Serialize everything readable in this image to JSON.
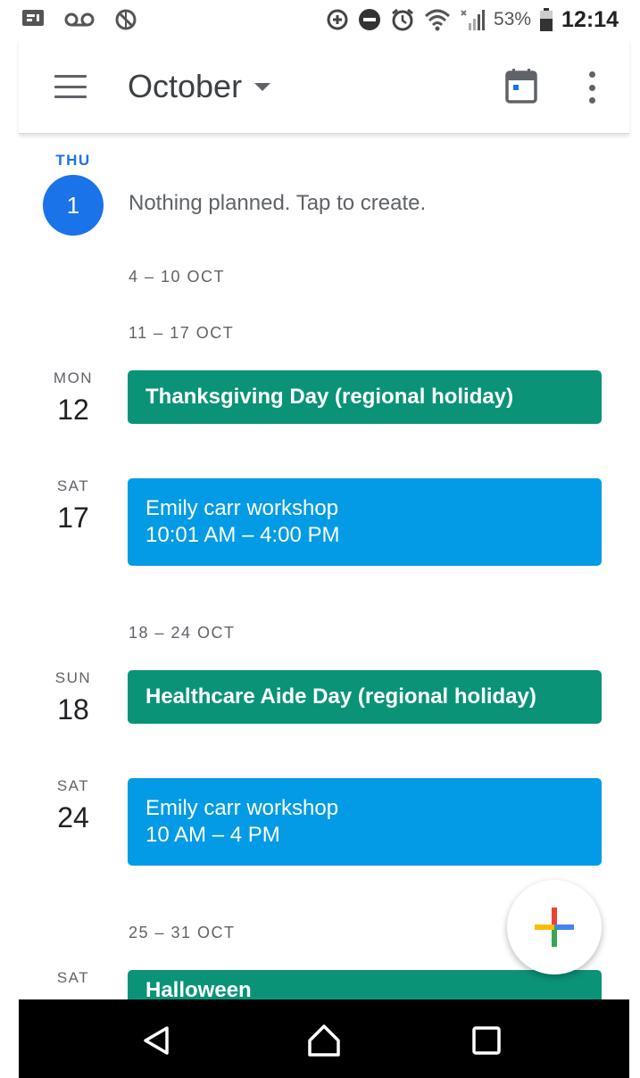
{
  "status_bar": {
    "battery_percent": "53%",
    "time": "12:14",
    "icons": [
      "notification-icon",
      "voicemail-icon",
      "sync-off-icon",
      "data-saver-icon",
      "do-not-disturb-icon",
      "alarm-icon",
      "wifi-icon",
      "signal-icon",
      "battery-icon"
    ]
  },
  "app_bar": {
    "month_title": "October",
    "icons": [
      "menu-icon",
      "chevron-down-icon",
      "calendar-today-icon",
      "more-vert-icon"
    ]
  },
  "today": {
    "day_name": "THU",
    "day_number": "1",
    "empty_message": "Nothing planned. Tap to create."
  },
  "weeks": [
    {
      "label": "4 – 10 OCT"
    },
    {
      "label": "11 – 17 OCT"
    },
    {
      "label": "18 – 24 OCT"
    },
    {
      "label": "25 – 31 OCT"
    }
  ],
  "days": [
    {
      "day_name": "MON",
      "day_number": "12",
      "event": {
        "title": "Thanksgiving Day (regional holiday)",
        "kind": "holiday",
        "color": "#0b9378"
      }
    },
    {
      "day_name": "SAT",
      "day_number": "17",
      "event": {
        "title": "Emily carr workshop",
        "time": "10:01 AM – 4:00 PM",
        "kind": "timed",
        "color": "#039be5"
      }
    },
    {
      "day_name": "SUN",
      "day_number": "18",
      "event": {
        "title": "Healthcare Aide Day (regional holiday)",
        "kind": "holiday",
        "color": "#0b9378"
      }
    },
    {
      "day_name": "SAT",
      "day_number": "24",
      "event": {
        "title": "Emily carr workshop",
        "time": "10 AM – 4 PM",
        "kind": "timed",
        "color": "#039be5"
      }
    },
    {
      "day_name": "SAT",
      "event": {
        "title": "Halloween",
        "kind": "holiday",
        "color": "#0b9378"
      }
    }
  ],
  "fab": {
    "icon": "plus-icon"
  },
  "nav_bar": {
    "icons": [
      "back-icon",
      "home-icon",
      "recents-icon"
    ]
  },
  "colors": {
    "accent_blue": "#1a73e8",
    "holiday_green": "#0b9378",
    "event_blue": "#039be5"
  }
}
